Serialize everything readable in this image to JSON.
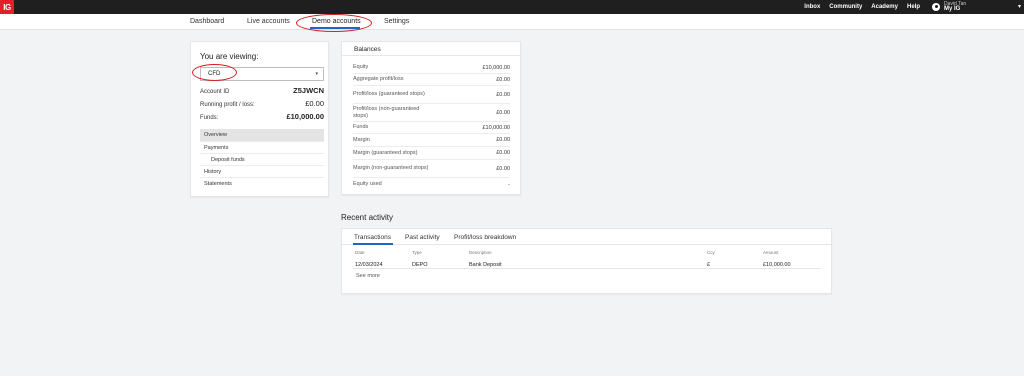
{
  "topbar": {
    "logo": "IG",
    "links": [
      "Inbox",
      "Community",
      "Academy",
      "Help"
    ],
    "user_name": "David Tan",
    "user_menu": "My IG"
  },
  "subnav": {
    "tabs": [
      "Dashboard",
      "Live accounts",
      "Demo accounts",
      "Settings"
    ]
  },
  "account_panel": {
    "title": "You are viewing:",
    "selected_account_type": "CFD",
    "account_id_label": "Account ID",
    "account_id": "Z5JWCN",
    "running_pl_label": "Running profit / loss:",
    "running_pl": "£0.00",
    "funds_label": "Funds:",
    "funds": "£10,000.00",
    "menu": [
      "Overview",
      "Payments",
      "Deposit funds",
      "History",
      "Statements"
    ]
  },
  "balances": {
    "title": "Balances",
    "rows": [
      {
        "label": "Equity",
        "value": "£10,000.00"
      },
      {
        "label": "Aggregate profit/loss",
        "value": "£0.00"
      },
      {
        "label": "Profit/loss (guaranteed stops)",
        "value": "£0.00"
      },
      {
        "label": "Profit/loss (non-guaranteed stops)",
        "value": "£0.00"
      },
      {
        "label": "Funds",
        "value": "£10,000.00"
      },
      {
        "label": "Margin",
        "value": "£0.00"
      },
      {
        "label": "Margin (guaranteed stops)",
        "value": "£0.00"
      },
      {
        "label": "Margin (non-guaranteed stops)",
        "value": "£0.00"
      },
      {
        "label": "Equity used",
        "value": "-"
      }
    ]
  },
  "recent_activity": {
    "title": "Recent activity",
    "tabs": [
      "Transactions",
      "Past activity",
      "Profit/loss breakdown"
    ],
    "columns": [
      "Date",
      "Type",
      "Description",
      "Ccy",
      "Amount"
    ],
    "rows": [
      [
        "12/03/2024",
        "DEPO",
        "Bank Deposit",
        "£",
        "£10,000.00"
      ]
    ],
    "see_more": "See more"
  },
  "colors": {
    "topbar_bg": "#1f1f1f",
    "brand_red": "#e0212b",
    "accent_blue": "#1c67c8",
    "annotation_red": "#d42027"
  },
  "icons": {
    "user": "user-circle-icon",
    "chevron": "chevron-down-icon",
    "select_caret": "caret-down-icon"
  }
}
